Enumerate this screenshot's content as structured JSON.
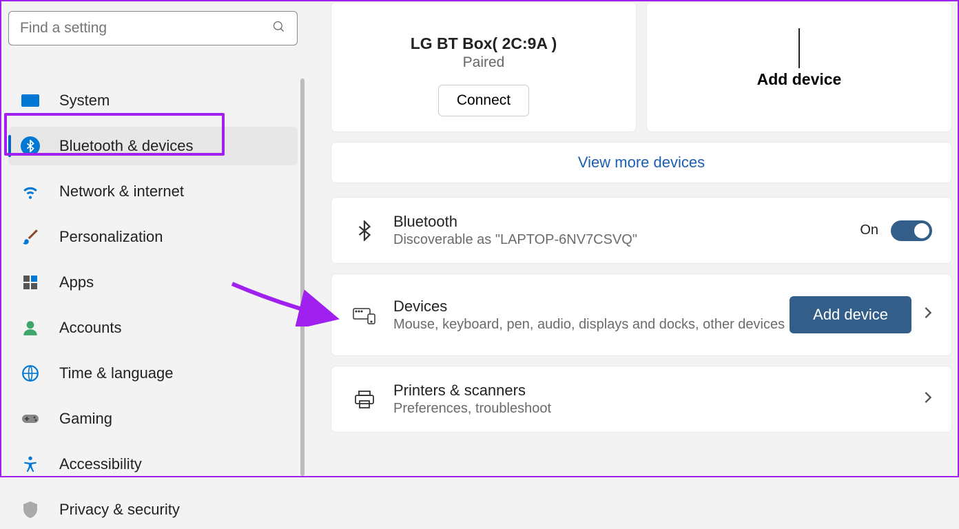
{
  "search": {
    "placeholder": "Find a setting"
  },
  "nav": {
    "items": [
      {
        "label": "System"
      },
      {
        "label": "Bluetooth & devices"
      },
      {
        "label": "Network & internet"
      },
      {
        "label": "Personalization"
      },
      {
        "label": "Apps"
      },
      {
        "label": "Accounts"
      },
      {
        "label": "Time & language"
      },
      {
        "label": "Gaming"
      },
      {
        "label": "Accessibility"
      },
      {
        "label": "Privacy & security"
      }
    ]
  },
  "device_card": {
    "name": "LG BT Box( 2C:9A )",
    "status": "Paired",
    "connect": "Connect"
  },
  "add_card": {
    "label": "Add device"
  },
  "view_more": "View more devices",
  "bluetooth_panel": {
    "title": "Bluetooth",
    "subtitle": "Discoverable as \"LAPTOP-6NV7CSVQ\"",
    "state": "On"
  },
  "devices_panel": {
    "title": "Devices",
    "subtitle": "Mouse, keyboard, pen, audio, displays and docks, other devices",
    "button": "Add device"
  },
  "printers_panel": {
    "title": "Printers & scanners",
    "subtitle": "Preferences, troubleshoot"
  }
}
